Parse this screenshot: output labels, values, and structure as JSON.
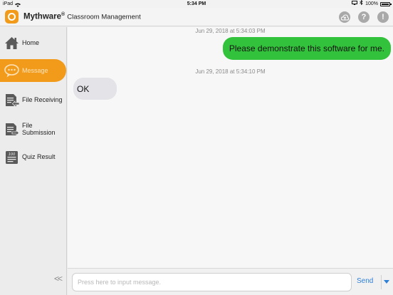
{
  "statusbar": {
    "device": "iPad",
    "time": "5:34 PM",
    "battery": "100%"
  },
  "header": {
    "brand_name": "Mythware",
    "brand_mark": "®",
    "brand_subtitle": "Classroom Management",
    "icons": [
      "cloud-icon",
      "help-icon",
      "alert-icon"
    ],
    "help_glyph": "?",
    "alert_glyph": "!"
  },
  "sidebar": {
    "items": [
      {
        "label": "Home",
        "icon": "home-icon"
      },
      {
        "label": "Message",
        "icon": "message-icon",
        "active": true
      },
      {
        "label": "File Receiving",
        "icon": "file-receiving-icon"
      },
      {
        "label": "File Submission",
        "icon": "file-submission-icon"
      },
      {
        "label": "Quiz Result",
        "icon": "quiz-result-icon"
      }
    ],
    "collapse_label": "<<"
  },
  "chat": {
    "messages": [
      {
        "timestamp": "Jun 29, 2018 at 5:34:03 PM",
        "text": "Please demonstrate this software for me.",
        "direction": "outgoing"
      },
      {
        "timestamp": "Jun 29, 2018 at 5:34:10 PM",
        "text": "OK",
        "direction": "incoming"
      }
    ]
  },
  "input": {
    "placeholder": "Press here to input message.",
    "value": "",
    "send_label": "Send"
  },
  "colors": {
    "accent": "#f29b1b",
    "outgoing_bubble": "#33c23b",
    "incoming_bubble": "#e3e3e8",
    "link": "#2d7fd8"
  }
}
